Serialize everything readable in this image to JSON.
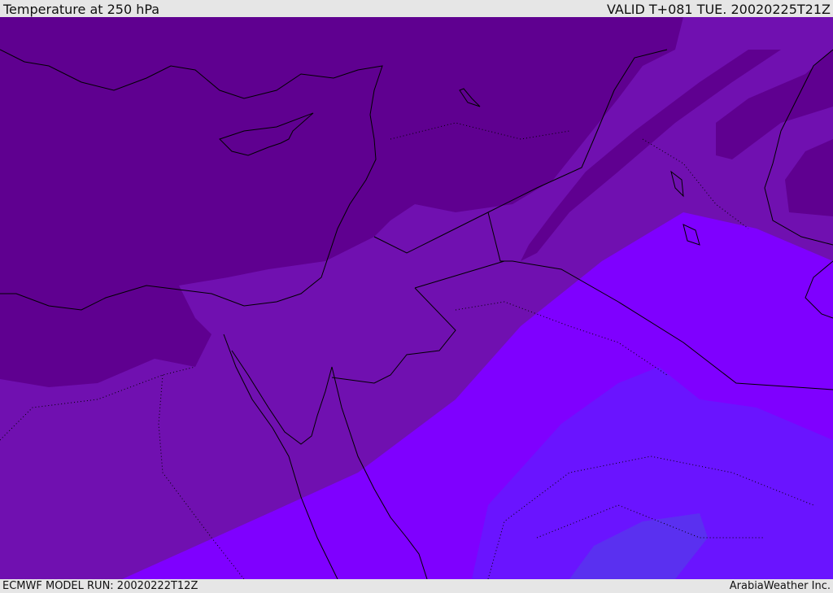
{
  "header": {
    "title": "Temperature at 250 hPa",
    "valid": "VALID T+081 TUE. 20020225T21Z"
  },
  "footer": {
    "model_run": "ECMWF MODEL RUN: 20020222T12Z",
    "credit": "ArabiaWeather Inc."
  },
  "colors": {
    "band_coldest": "#5f0090",
    "band_cold": "#7010b0",
    "band_mid": "#7f00ff",
    "band_warm": "#6a14ff",
    "band_warmest": "#5a30f0",
    "coast": "#000000"
  }
}
